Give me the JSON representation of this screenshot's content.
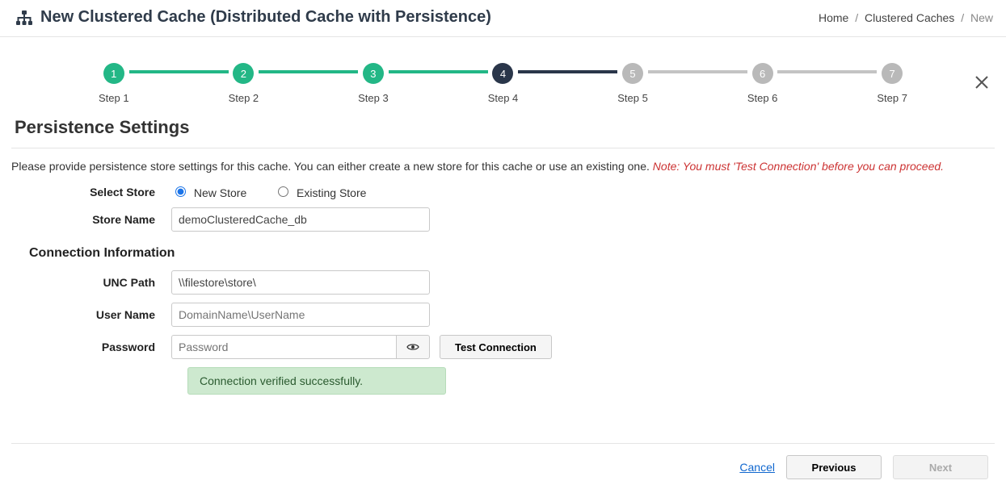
{
  "header": {
    "title": "New Clustered Cache (Distributed Cache with Persistence)"
  },
  "breadcrumb": {
    "items": [
      "Home",
      "Clustered Caches",
      "New"
    ],
    "sep": "/"
  },
  "stepper": {
    "steps": [
      {
        "num": "1",
        "label": "Step 1",
        "state": "done"
      },
      {
        "num": "2",
        "label": "Step 2",
        "state": "done"
      },
      {
        "num": "3",
        "label": "Step 3",
        "state": "done"
      },
      {
        "num": "4",
        "label": "Step 4",
        "state": "active"
      },
      {
        "num": "5",
        "label": "Step 5",
        "state": "future"
      },
      {
        "num": "6",
        "label": "Step 6",
        "state": "future"
      },
      {
        "num": "7",
        "label": "Step 7",
        "state": "future"
      }
    ]
  },
  "section": {
    "title": "Persistence Settings",
    "help_prefix": "Please provide persistence store settings for this cache. You can either create a new store for this cache or use an existing one. ",
    "help_note": "Note: You must 'Test Connection' before you can proceed."
  },
  "labels": {
    "select_store": "Select Store",
    "store_name": "Store Name",
    "conn_info": "Connection Information",
    "unc_path": "UNC Path",
    "user_name": "User Name",
    "password": "Password"
  },
  "radios": {
    "new_store": "New Store",
    "existing_store": "Existing Store",
    "selected": "new"
  },
  "values": {
    "store_name": "demoClusteredCache_db",
    "unc_path": "\\\\filestore\\store\\",
    "user_name_placeholder": "DomainName\\UserName",
    "password_placeholder": "Password"
  },
  "buttons": {
    "test_connection": "Test Connection",
    "cancel": "Cancel",
    "previous": "Previous",
    "next": "Next"
  },
  "status": {
    "success": "Connection verified successfully."
  }
}
